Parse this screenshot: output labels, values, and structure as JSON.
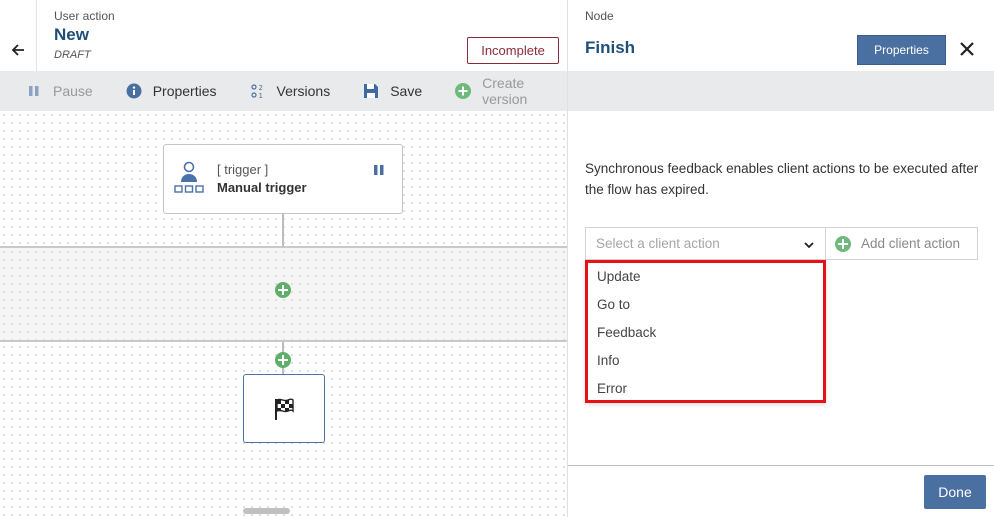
{
  "left_header": {
    "subtitle": "User action",
    "title": "New",
    "state": "DRAFT",
    "status_badge": "Incomplete"
  },
  "toolbar": {
    "items": [
      {
        "label": "Pause",
        "icon": "pause-icon",
        "enabled": false
      },
      {
        "label": "Properties",
        "icon": "info-icon",
        "enabled": true
      },
      {
        "label": "Versions",
        "icon": "versions-icon",
        "enabled": true
      },
      {
        "label": "Save",
        "icon": "save-icon",
        "enabled": true
      },
      {
        "label": "Create version",
        "icon": "plus-circle-icon",
        "enabled": false
      }
    ]
  },
  "canvas": {
    "trigger_node": {
      "type": "[ trigger ]",
      "name": "Manual trigger",
      "icon": "user-hierarchy-icon"
    },
    "finish_node": {
      "icon": "checkered-flag-icon"
    }
  },
  "right_panel": {
    "subtitle": "Node",
    "title": "Finish",
    "properties_label": "Properties",
    "description": "Synchronous feedback enables client actions to be executed after the flow has expired.",
    "select_placeholder": "Select a client action",
    "add_action_label": "Add client action",
    "dropdown_options": [
      "Update",
      "Go to",
      "Feedback",
      "Info",
      "Error"
    ],
    "done_label": "Done"
  },
  "colors": {
    "accent": "#4a6fa1",
    "title": "#1f4e79",
    "incomplete": "#8b2b3a",
    "add": "#5fae6a",
    "highlight": "#e8111b"
  }
}
